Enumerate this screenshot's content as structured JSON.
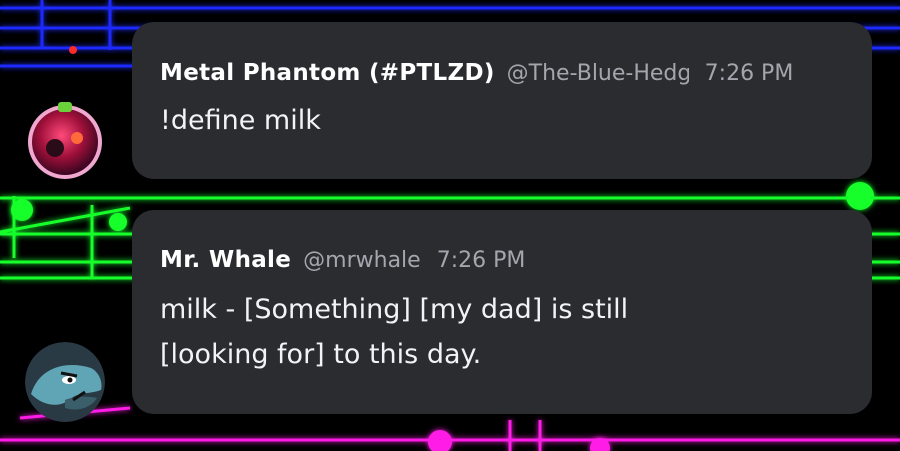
{
  "messages": [
    {
      "author": "Metal Phantom (#PTLZD)",
      "handle": "@The-Blue-Hedgehog",
      "time": "7:26 PM",
      "content": "!define milk",
      "avatar": "ornament-avatar"
    },
    {
      "author": "Mr. Whale",
      "handle": "@mrwhale",
      "time": "7:26 PM",
      "content_lines": [
        "milk - [Something] [my dad] is still",
        "[looking for] to this day."
      ],
      "avatar": "whale-avatar"
    }
  ],
  "colors": {
    "bubble": "#2b2c30",
    "author": "#ffffff",
    "meta": "#a3a6ad",
    "text": "#f2f3f5",
    "staff_blue": "#1a2cff",
    "staff_green": "#18ff2a",
    "staff_pink": "#ff1ee6"
  },
  "background": "neon-music-staff"
}
